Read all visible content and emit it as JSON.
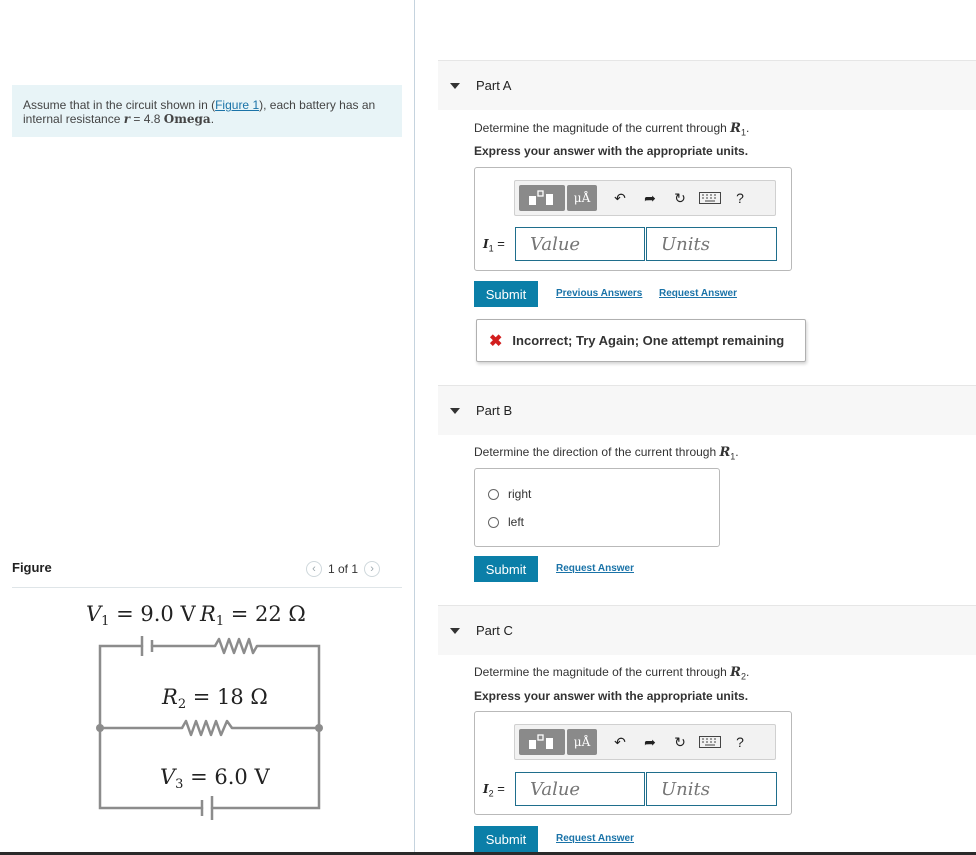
{
  "problem": {
    "prompt_before": "Assume that in the circuit shown in (",
    "figure_link": "Figure 1",
    "prompt_mid": "), each battery has an internal resistance ",
    "r_symbol": "r",
    "r_value": " = 4.8 ",
    "r_unit": "Omega",
    "r_end": "."
  },
  "figure": {
    "label": "Figure",
    "pager": "1 of 1",
    "prev_icon": "chevron-left-icon",
    "next_icon": "chevron-right-icon",
    "circuit": {
      "v1": "V",
      "v1_sub": "1",
      "v1_rest": " = 9.0 V",
      "r1": "R",
      "r1_sub": "1",
      "r1_rest": " = 22 Ω",
      "r2": "R",
      "r2_sub": "2",
      "r2_rest": " = 18 Ω",
      "v3": "V",
      "v3_sub": "3",
      "v3_rest": " = 6.0 V"
    }
  },
  "toolbar": {
    "units_symbol": "μÅ",
    "undo_icon": "undo-icon",
    "redo_icon": "redo-icon",
    "reset_icon": "reset-icon",
    "keyboard_icon": "keyboard-icon",
    "help_label": "?"
  },
  "partA": {
    "title": "Part A",
    "question_prefix": "Determine the magnitude of the current through ",
    "question_sym": "R",
    "question_sub": "1",
    "question_end": ".",
    "instruction": "Express your answer with the appropriate units.",
    "var": "I",
    "var_sub": "1",
    "eq": " =",
    "value_placeholder": "Value",
    "units_placeholder": "Units",
    "submit": "Submit",
    "link1": "Previous Answers",
    "link2": "Request Answer",
    "feedback": "Incorrect; Try Again; One attempt remaining"
  },
  "partB": {
    "title": "Part B",
    "question_prefix": "Determine the direction of the current through ",
    "question_sym": "R",
    "question_sub": "1",
    "question_end": ".",
    "options": [
      "right",
      "left"
    ],
    "submit": "Submit",
    "link": "Request Answer"
  },
  "partC": {
    "title": "Part C",
    "question_prefix": "Determine the magnitude of the current through ",
    "question_sym": "R",
    "question_sub": "2",
    "question_end": ".",
    "instruction": "Express your answer with the appropriate units.",
    "var": "I",
    "var_sub": "2",
    "eq": " =",
    "value_placeholder": "Value",
    "units_placeholder": "Units",
    "submit": "Submit",
    "link": "Request Answer"
  }
}
